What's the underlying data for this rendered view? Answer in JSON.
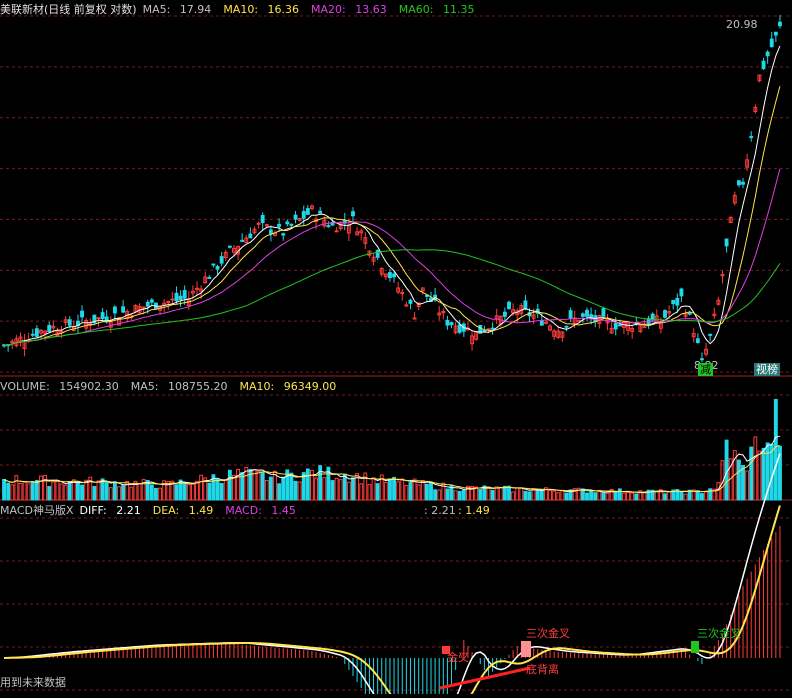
{
  "colors": {
    "up": "#ff3c3c",
    "down": "#1fd8e8",
    "ma5": "#ffffff",
    "ma10": "#ffe44c",
    "ma20": "#e040e0",
    "ma60": "#22c422",
    "grid": "#7a1a1a",
    "text": "#c0c0c0",
    "diff": "#ffffff",
    "dea": "#ffe44c",
    "macd_pos": "#ff3c3c",
    "macd_neg": "#1fd8e8"
  },
  "header": {
    "title": "美联新材(日线 前复权 对数)",
    "ma5_label": "MA5:",
    "ma5_value": "17.94",
    "ma10_label": "MA10:",
    "ma10_value": "16.36",
    "ma20_label": "MA20:",
    "ma20_value": "13.63",
    "ma60_label": "MA60:",
    "ma60_value": "11.35"
  },
  "price_panel": {
    "high_label": "20.98",
    "low_label": "8.82",
    "tag_minus": "减",
    "tag_bang": "视榜"
  },
  "volume_panel": {
    "label": "VOLUME:",
    "value": "154902.30",
    "ma5_label": "MA5:",
    "ma5_value": "108755.20",
    "ma10_label": "MA10:",
    "ma10_value": "96349.00"
  },
  "macd_panel": {
    "name": "MACD神马版X",
    "diff_label": "DIFF:",
    "diff_value": "2.21",
    "dea_label": "DEA:",
    "dea_value": "1.49",
    "macd_label": "MACD:",
    "macd_value": "1.45",
    "extra1": ": 2.21",
    "extra2": ": 1.49",
    "signal_golden": "金叉",
    "signal_triple1": "三次金叉",
    "signal_bottom": "底背离",
    "signal_triple2": "三次金叉",
    "footer": "用到未来数据"
  },
  "chart_data": {
    "type": "candlestick",
    "title": "美联新材(日线 前复权 对数)",
    "count": 190,
    "y_price_range": [
      8.8,
      21.0
    ],
    "anchors_close": [
      [
        0,
        9.4
      ],
      [
        10,
        9.8
      ],
      [
        25,
        10.1
      ],
      [
        35,
        10.4
      ],
      [
        45,
        10.6
      ],
      [
        55,
        11.9
      ],
      [
        62,
        12.7
      ],
      [
        68,
        12.5
      ],
      [
        75,
        13.2
      ],
      [
        80,
        12.7
      ],
      [
        85,
        12.9
      ],
      [
        90,
        11.9
      ],
      [
        100,
        10.2
      ],
      [
        102,
        10.8
      ],
      [
        108,
        10.0
      ],
      [
        115,
        9.7
      ],
      [
        120,
        10.0
      ],
      [
        125,
        10.3
      ],
      [
        130,
        10.1
      ],
      [
        135,
        9.8
      ],
      [
        140,
        10.1
      ],
      [
        150,
        9.9
      ],
      [
        160,
        10.0
      ],
      [
        165,
        10.6
      ],
      [
        168,
        9.8
      ],
      [
        170,
        9.0
      ],
      [
        172,
        9.6
      ],
      [
        174,
        10.5
      ],
      [
        176,
        12.0
      ],
      [
        178,
        13.6
      ],
      [
        180,
        14.2
      ],
      [
        182,
        16.0
      ],
      [
        184,
        18.5
      ],
      [
        186,
        19.5
      ],
      [
        188,
        20.4
      ],
      [
        189,
        20.9
      ]
    ],
    "anchors_volume": [
      [
        0,
        0.2
      ],
      [
        20,
        0.18
      ],
      [
        40,
        0.15
      ],
      [
        58,
        0.26
      ],
      [
        66,
        0.22
      ],
      [
        75,
        0.27
      ],
      [
        84,
        0.25
      ],
      [
        90,
        0.2
      ],
      [
        110,
        0.12
      ],
      [
        130,
        0.1
      ],
      [
        160,
        0.08
      ],
      [
        170,
        0.08
      ],
      [
        174,
        0.14
      ],
      [
        176,
        0.55
      ],
      [
        178,
        0.42
      ],
      [
        180,
        0.3
      ],
      [
        182,
        0.45
      ],
      [
        184,
        0.62
      ],
      [
        186,
        0.48
      ],
      [
        188,
        0.8
      ],
      [
        189,
        0.65
      ]
    ],
    "anchors_macd_hist": [
      [
        0,
        0
      ],
      [
        15,
        0.05
      ],
      [
        35,
        0.1
      ],
      [
        55,
        0.12
      ],
      [
        75,
        0.06
      ],
      [
        82,
        0
      ],
      [
        88,
        -0.3
      ],
      [
        92,
        -0.5
      ],
      [
        100,
        -0.55
      ],
      [
        108,
        -0.35
      ],
      [
        112,
        0.15
      ],
      [
        118,
        -0.15
      ],
      [
        125,
        0.1
      ],
      [
        135,
        0.05
      ],
      [
        150,
        0.02
      ],
      [
        165,
        0.08
      ],
      [
        170,
        -0.05
      ],
      [
        175,
        0.2
      ],
      [
        180,
        0.6
      ],
      [
        185,
        0.9
      ],
      [
        189,
        1.1
      ]
    ]
  }
}
